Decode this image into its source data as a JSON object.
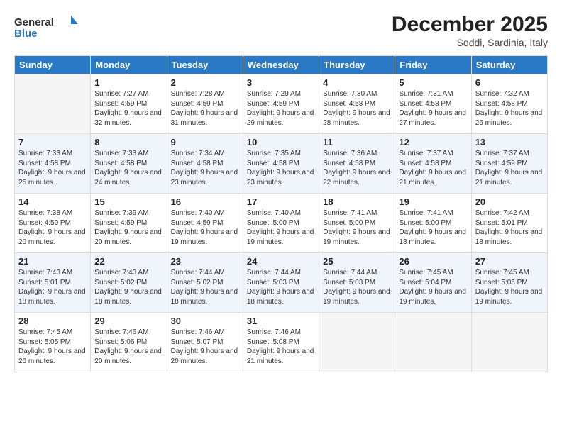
{
  "logo": {
    "line1": "General",
    "line2": "Blue"
  },
  "title": "December 2025",
  "location": "Soddi, Sardinia, Italy",
  "headers": [
    "Sunday",
    "Monday",
    "Tuesday",
    "Wednesday",
    "Thursday",
    "Friday",
    "Saturday"
  ],
  "weeks": [
    [
      {
        "day": "",
        "sunrise": "",
        "sunset": "",
        "daylight": ""
      },
      {
        "day": "1",
        "sunrise": "Sunrise: 7:27 AM",
        "sunset": "Sunset: 4:59 PM",
        "daylight": "Daylight: 9 hours and 32 minutes."
      },
      {
        "day": "2",
        "sunrise": "Sunrise: 7:28 AM",
        "sunset": "Sunset: 4:59 PM",
        "daylight": "Daylight: 9 hours and 31 minutes."
      },
      {
        "day": "3",
        "sunrise": "Sunrise: 7:29 AM",
        "sunset": "Sunset: 4:59 PM",
        "daylight": "Daylight: 9 hours and 29 minutes."
      },
      {
        "day": "4",
        "sunrise": "Sunrise: 7:30 AM",
        "sunset": "Sunset: 4:58 PM",
        "daylight": "Daylight: 9 hours and 28 minutes."
      },
      {
        "day": "5",
        "sunrise": "Sunrise: 7:31 AM",
        "sunset": "Sunset: 4:58 PM",
        "daylight": "Daylight: 9 hours and 27 minutes."
      },
      {
        "day": "6",
        "sunrise": "Sunrise: 7:32 AM",
        "sunset": "Sunset: 4:58 PM",
        "daylight": "Daylight: 9 hours and 26 minutes."
      }
    ],
    [
      {
        "day": "7",
        "sunrise": "Sunrise: 7:33 AM",
        "sunset": "Sunset: 4:58 PM",
        "daylight": "Daylight: 9 hours and 25 minutes."
      },
      {
        "day": "8",
        "sunrise": "Sunrise: 7:33 AM",
        "sunset": "Sunset: 4:58 PM",
        "daylight": "Daylight: 9 hours and 24 minutes."
      },
      {
        "day": "9",
        "sunrise": "Sunrise: 7:34 AM",
        "sunset": "Sunset: 4:58 PM",
        "daylight": "Daylight: 9 hours and 23 minutes."
      },
      {
        "day": "10",
        "sunrise": "Sunrise: 7:35 AM",
        "sunset": "Sunset: 4:58 PM",
        "daylight": "Daylight: 9 hours and 23 minutes."
      },
      {
        "day": "11",
        "sunrise": "Sunrise: 7:36 AM",
        "sunset": "Sunset: 4:58 PM",
        "daylight": "Daylight: 9 hours and 22 minutes."
      },
      {
        "day": "12",
        "sunrise": "Sunrise: 7:37 AM",
        "sunset": "Sunset: 4:58 PM",
        "daylight": "Daylight: 9 hours and 21 minutes."
      },
      {
        "day": "13",
        "sunrise": "Sunrise: 7:37 AM",
        "sunset": "Sunset: 4:59 PM",
        "daylight": "Daylight: 9 hours and 21 minutes."
      }
    ],
    [
      {
        "day": "14",
        "sunrise": "Sunrise: 7:38 AM",
        "sunset": "Sunset: 4:59 PM",
        "daylight": "Daylight: 9 hours and 20 minutes."
      },
      {
        "day": "15",
        "sunrise": "Sunrise: 7:39 AM",
        "sunset": "Sunset: 4:59 PM",
        "daylight": "Daylight: 9 hours and 20 minutes."
      },
      {
        "day": "16",
        "sunrise": "Sunrise: 7:40 AM",
        "sunset": "Sunset: 4:59 PM",
        "daylight": "Daylight: 9 hours and 19 minutes."
      },
      {
        "day": "17",
        "sunrise": "Sunrise: 7:40 AM",
        "sunset": "Sunset: 5:00 PM",
        "daylight": "Daylight: 9 hours and 19 minutes."
      },
      {
        "day": "18",
        "sunrise": "Sunrise: 7:41 AM",
        "sunset": "Sunset: 5:00 PM",
        "daylight": "Daylight: 9 hours and 19 minutes."
      },
      {
        "day": "19",
        "sunrise": "Sunrise: 7:41 AM",
        "sunset": "Sunset: 5:00 PM",
        "daylight": "Daylight: 9 hours and 18 minutes."
      },
      {
        "day": "20",
        "sunrise": "Sunrise: 7:42 AM",
        "sunset": "Sunset: 5:01 PM",
        "daylight": "Daylight: 9 hours and 18 minutes."
      }
    ],
    [
      {
        "day": "21",
        "sunrise": "Sunrise: 7:43 AM",
        "sunset": "Sunset: 5:01 PM",
        "daylight": "Daylight: 9 hours and 18 minutes."
      },
      {
        "day": "22",
        "sunrise": "Sunrise: 7:43 AM",
        "sunset": "Sunset: 5:02 PM",
        "daylight": "Daylight: 9 hours and 18 minutes."
      },
      {
        "day": "23",
        "sunrise": "Sunrise: 7:44 AM",
        "sunset": "Sunset: 5:02 PM",
        "daylight": "Daylight: 9 hours and 18 minutes."
      },
      {
        "day": "24",
        "sunrise": "Sunrise: 7:44 AM",
        "sunset": "Sunset: 5:03 PM",
        "daylight": "Daylight: 9 hours and 18 minutes."
      },
      {
        "day": "25",
        "sunrise": "Sunrise: 7:44 AM",
        "sunset": "Sunset: 5:03 PM",
        "daylight": "Daylight: 9 hours and 19 minutes."
      },
      {
        "day": "26",
        "sunrise": "Sunrise: 7:45 AM",
        "sunset": "Sunset: 5:04 PM",
        "daylight": "Daylight: 9 hours and 19 minutes."
      },
      {
        "day": "27",
        "sunrise": "Sunrise: 7:45 AM",
        "sunset": "Sunset: 5:05 PM",
        "daylight": "Daylight: 9 hours and 19 minutes."
      }
    ],
    [
      {
        "day": "28",
        "sunrise": "Sunrise: 7:45 AM",
        "sunset": "Sunset: 5:05 PM",
        "daylight": "Daylight: 9 hours and 20 minutes."
      },
      {
        "day": "29",
        "sunrise": "Sunrise: 7:46 AM",
        "sunset": "Sunset: 5:06 PM",
        "daylight": "Daylight: 9 hours and 20 minutes."
      },
      {
        "day": "30",
        "sunrise": "Sunrise: 7:46 AM",
        "sunset": "Sunset: 5:07 PM",
        "daylight": "Daylight: 9 hours and 20 minutes."
      },
      {
        "day": "31",
        "sunrise": "Sunrise: 7:46 AM",
        "sunset": "Sunset: 5:08 PM",
        "daylight": "Daylight: 9 hours and 21 minutes."
      },
      {
        "day": "",
        "sunrise": "",
        "sunset": "",
        "daylight": ""
      },
      {
        "day": "",
        "sunrise": "",
        "sunset": "",
        "daylight": ""
      },
      {
        "day": "",
        "sunrise": "",
        "sunset": "",
        "daylight": ""
      }
    ]
  ]
}
